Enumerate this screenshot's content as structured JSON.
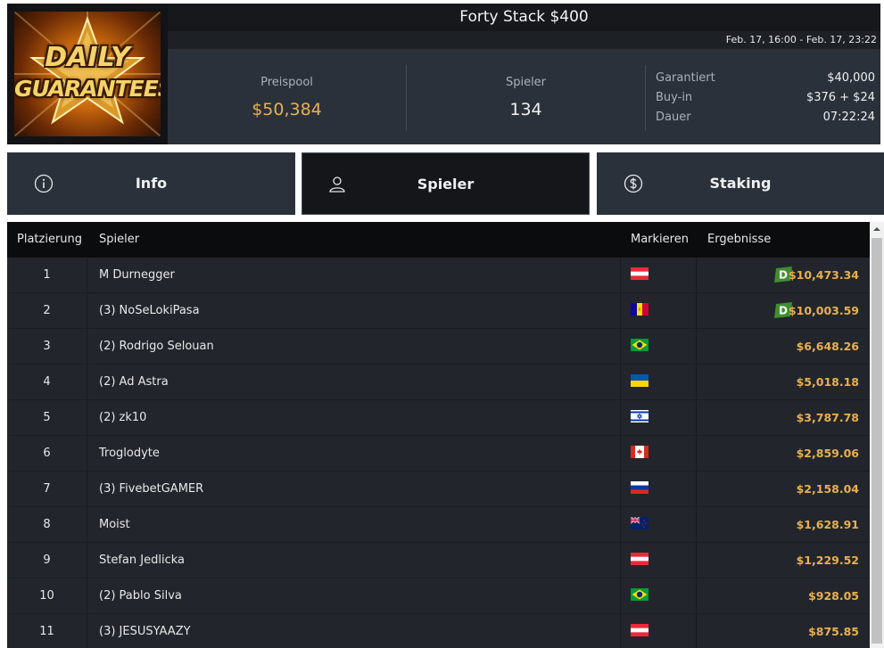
{
  "logo": {
    "line1": "DAILY",
    "line2": "GUARANTEES"
  },
  "tournament": {
    "title": "Forty Stack $400",
    "dates": "Feb. 17, 16:00 - Feb. 17, 23:22"
  },
  "stats": {
    "prizepool_label": "Preispool",
    "prizepool_value": "$50,384",
    "players_label": "Spieler",
    "players_value": "134",
    "guaranteed_label": "Garantiert",
    "guaranteed_value": "$40,000",
    "buyin_label": "Buy-in",
    "buyin_value": "$376 + $24",
    "duration_label": "Dauer",
    "duration_value": "07:22:24"
  },
  "tabs": [
    {
      "label": "Info",
      "icon": "info-icon"
    },
    {
      "label": "Spieler",
      "icon": "user-icon",
      "active": true
    },
    {
      "label": "Staking",
      "icon": "dollar-coin-icon"
    }
  ],
  "table": {
    "headers": {
      "rank": "Platzierung",
      "player": "Spieler",
      "flag": "Markieren",
      "result": "Ergebnisse"
    },
    "rows": [
      {
        "rank": "1",
        "player": "M Durnegger",
        "flag": "austria",
        "result": "$10,473.34",
        "badge": "D"
      },
      {
        "rank": "2",
        "player": "(3) NoSeLokiPasa",
        "flag": "andorra",
        "result": "$10,003.59",
        "badge": "D"
      },
      {
        "rank": "3",
        "player": "(2) Rodrigo Selouan",
        "flag": "brazil",
        "result": "$6,648.26"
      },
      {
        "rank": "4",
        "player": "(2) Ad Astra",
        "flag": "ukraine",
        "result": "$5,018.18"
      },
      {
        "rank": "5",
        "player": "(2) zk10",
        "flag": "israel",
        "result": "$3,787.78"
      },
      {
        "rank": "6",
        "player": "Troglodyte",
        "flag": "canada",
        "result": "$2,859.06"
      },
      {
        "rank": "7",
        "player": "(3) FivebetGAMER",
        "flag": "russia",
        "result": "$2,158.04"
      },
      {
        "rank": "8",
        "player": "Moist",
        "flag": "new-zealand",
        "result": "$1,628.91"
      },
      {
        "rank": "9",
        "player": "Stefan Jedlicka",
        "flag": "austria",
        "result": "$1,229.52"
      },
      {
        "rank": "10",
        "player": "(2) Pablo Silva",
        "flag": "brazil",
        "result": "$928.05"
      },
      {
        "rank": "11",
        "player": "(3) JESUSYAAZY",
        "flag": "austria",
        "result": "$875.85"
      }
    ]
  },
  "colors": {
    "accent_gold": "#e8b04e",
    "panel": "#2b313a",
    "table_bg": "#22262c",
    "header_bg": "#0b0c0e"
  }
}
